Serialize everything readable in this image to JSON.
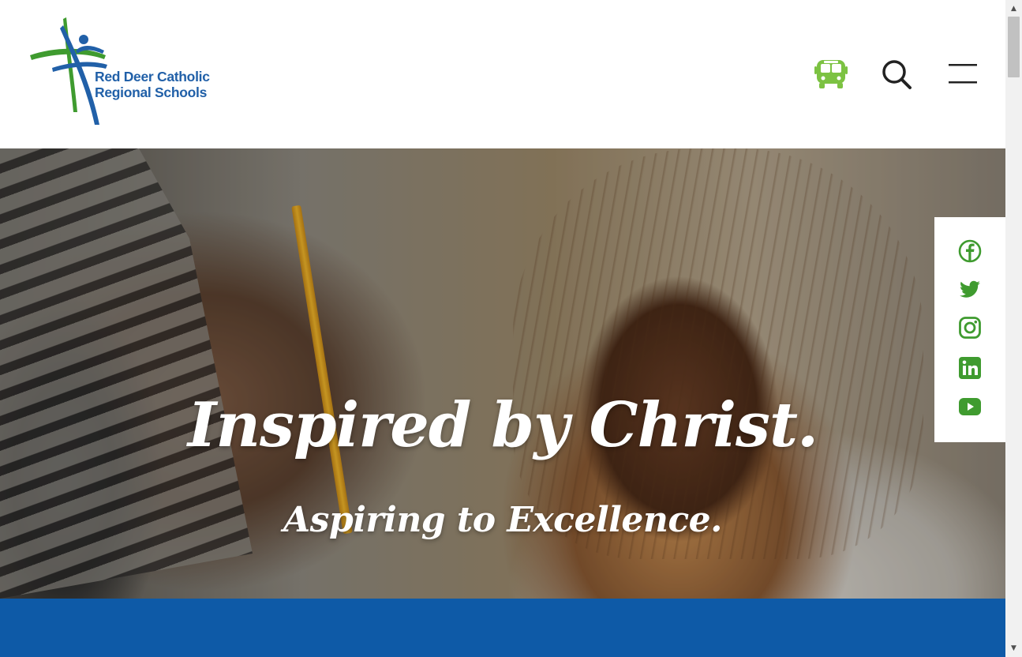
{
  "header": {
    "logo_line1": "Red Deer Catholic",
    "logo_line2": "Regional Schools",
    "icons": [
      "bus-icon",
      "search-icon",
      "menu-icon"
    ]
  },
  "hero": {
    "heading": "Inspired by Christ.",
    "subheading": "Aspiring to Excellence."
  },
  "social": {
    "icons": [
      "facebook-icon",
      "twitter-icon",
      "instagram-icon",
      "linkedin-icon",
      "youtube-icon"
    ],
    "color": "#3f9b2f"
  },
  "colors": {
    "brand_blue": "#2160a8",
    "brand_green": "#3f9b2f",
    "bus_green": "#7cc242",
    "band_blue": "#0e5aa7"
  }
}
